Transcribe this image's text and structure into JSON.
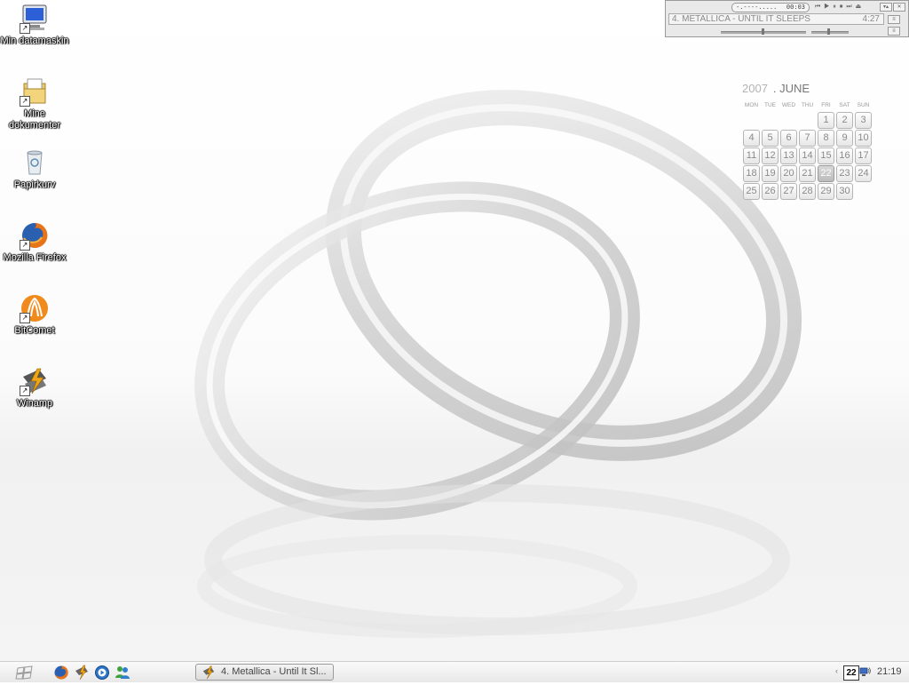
{
  "desktop": {
    "icons": [
      {
        "label": "Min datamaskin",
        "icon": "computer-icon"
      },
      {
        "label": "Mine\ndokumenter",
        "icon": "documents-folder-icon"
      },
      {
        "label": "Papirkurv",
        "icon": "recycle-bin-icon"
      },
      {
        "label": "Mozilla Firefox",
        "icon": "firefox-icon"
      },
      {
        "label": "BitComet",
        "icon": "bitcomet-icon"
      },
      {
        "label": "Winamp",
        "icon": "winamp-icon"
      }
    ]
  },
  "winamp": {
    "time_dashes": "-.----.....",
    "elapsed": "00:03",
    "controls": "⏮ ▶ ⏸ ⏹ ⏭ ⏏",
    "track": "4. METALLICA - UNTIL IT SLEEPS",
    "duration": "4:27"
  },
  "calendar": {
    "year": "2007",
    "month": ". JUNE",
    "weekdays": [
      "MON",
      "TUE",
      "WED",
      "THU",
      "FRI",
      "SAT",
      "SUN"
    ],
    "first_weekday_index": 4,
    "days_in_month": 30,
    "today": 22
  },
  "taskbar": {
    "task_title": "4. Metallica - Until It Sl...",
    "tray_date": "22",
    "clock": "21:19",
    "quick_launch": [
      "firefox-icon",
      "winamp-icon",
      "media-player-icon",
      "messenger-icon"
    ]
  },
  "colors": {
    "accent_gray": "#8a8a8a",
    "today_bg": "#c4c4c4"
  }
}
